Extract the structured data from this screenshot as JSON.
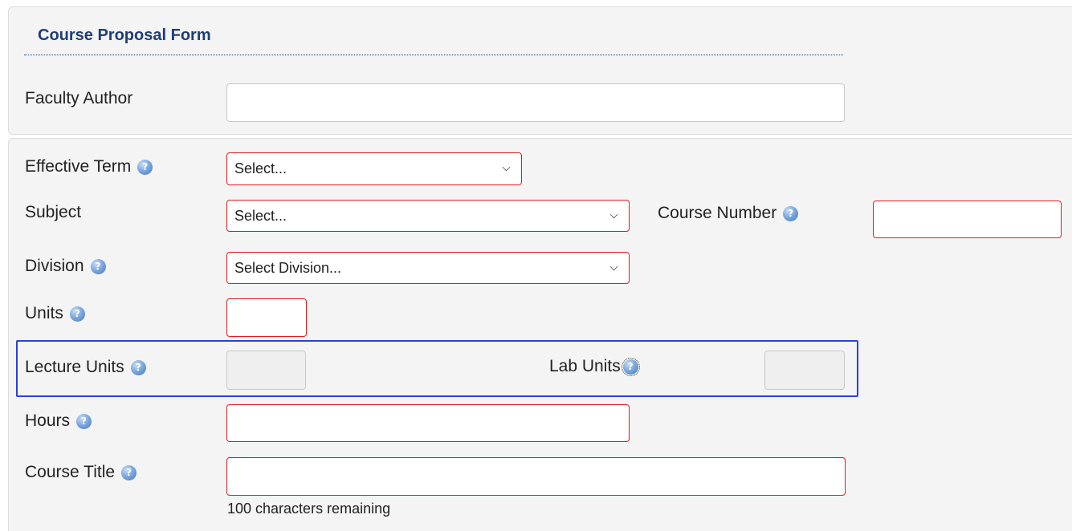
{
  "form": {
    "title": "Course Proposal Form",
    "faculty_author": {
      "label": "Faculty Author",
      "value": ""
    },
    "effective_term": {
      "label": "Effective Term",
      "selected": "Select..."
    },
    "subject": {
      "label": "Subject",
      "selected": "Select..."
    },
    "course_number": {
      "label": "Course Number",
      "value": ""
    },
    "division": {
      "label": "Division",
      "selected": "Select Division..."
    },
    "units": {
      "label": "Units",
      "value": ""
    },
    "lecture_units": {
      "label": "Lecture Units",
      "value": ""
    },
    "lab_units": {
      "label": "Lab Units",
      "value": ""
    },
    "hours": {
      "label": "Hours",
      "value": ""
    },
    "course_title": {
      "label": "Course Title",
      "value": "",
      "hint": "100 characters remaining"
    }
  },
  "icons": {
    "help": "help-question-icon"
  },
  "colors": {
    "title": "#1f3d73",
    "required_border": "#e01b1b",
    "group_highlight": "#2a3fe0",
    "panel_bg": "#f4f4f4"
  }
}
